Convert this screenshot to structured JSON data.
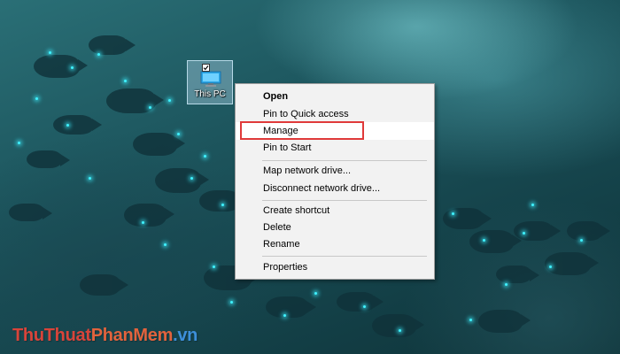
{
  "desktop": {
    "icon": {
      "name": "computer-icon",
      "label": "This PC"
    }
  },
  "context_menu": {
    "items": [
      {
        "label": "Open",
        "bold": true
      },
      {
        "label": "Pin to Quick access"
      },
      {
        "label": "Manage",
        "highlighted": true
      },
      {
        "label": "Pin to Start"
      },
      {
        "label": "Map network drive..."
      },
      {
        "label": "Disconnect network drive..."
      },
      {
        "label": "Create shortcut"
      },
      {
        "label": "Delete"
      },
      {
        "label": "Rename"
      },
      {
        "label": "Properties"
      }
    ]
  },
  "highlight_color": "#e03a3a",
  "watermark": {
    "part1": "ThuThuat",
    "part2": "PhanMem",
    "part3": ".vn",
    "colors": [
      "#d9443a",
      "#e2633d",
      "#3d8fd9"
    ]
  }
}
